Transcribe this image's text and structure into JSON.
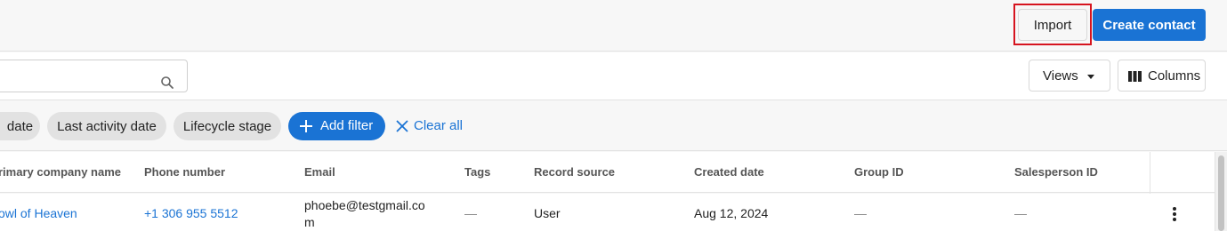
{
  "toolbar": {
    "import_label": "Import",
    "create_label": "Create contact"
  },
  "search": {
    "placeholder": "",
    "value": ""
  },
  "view_controls": {
    "views_label": "Views",
    "columns_label": "Columns"
  },
  "filters": {
    "chips": [
      "date",
      "Last activity date",
      "Lifecycle stage"
    ],
    "add_filter_label": "Add filter",
    "clear_all_label": "Clear all"
  },
  "table": {
    "columns": [
      "rimary company name",
      "Phone number",
      "Email",
      "Tags",
      "Record source",
      "Created date",
      "Group ID",
      "Salesperson ID"
    ],
    "rows": [
      {
        "company": "owl of Heaven",
        "phone": "+1 306 955 5512",
        "email": "phoebe@testgmail.com",
        "tags": "—",
        "record_source": "User",
        "created_date": "Aug 12, 2024",
        "group_id": "—",
        "salesperson_id": "—"
      }
    ]
  },
  "colors": {
    "accent": "#1a73d4",
    "highlight": "#d6141f",
    "chip_bg": "#e2e2e2"
  },
  "icons": {
    "search": "search-icon",
    "views_caret": "caret-down-icon",
    "columns": "columns-icon",
    "add": "plus-icon",
    "clear": "close-icon",
    "row_menu": "more-vertical-icon"
  }
}
